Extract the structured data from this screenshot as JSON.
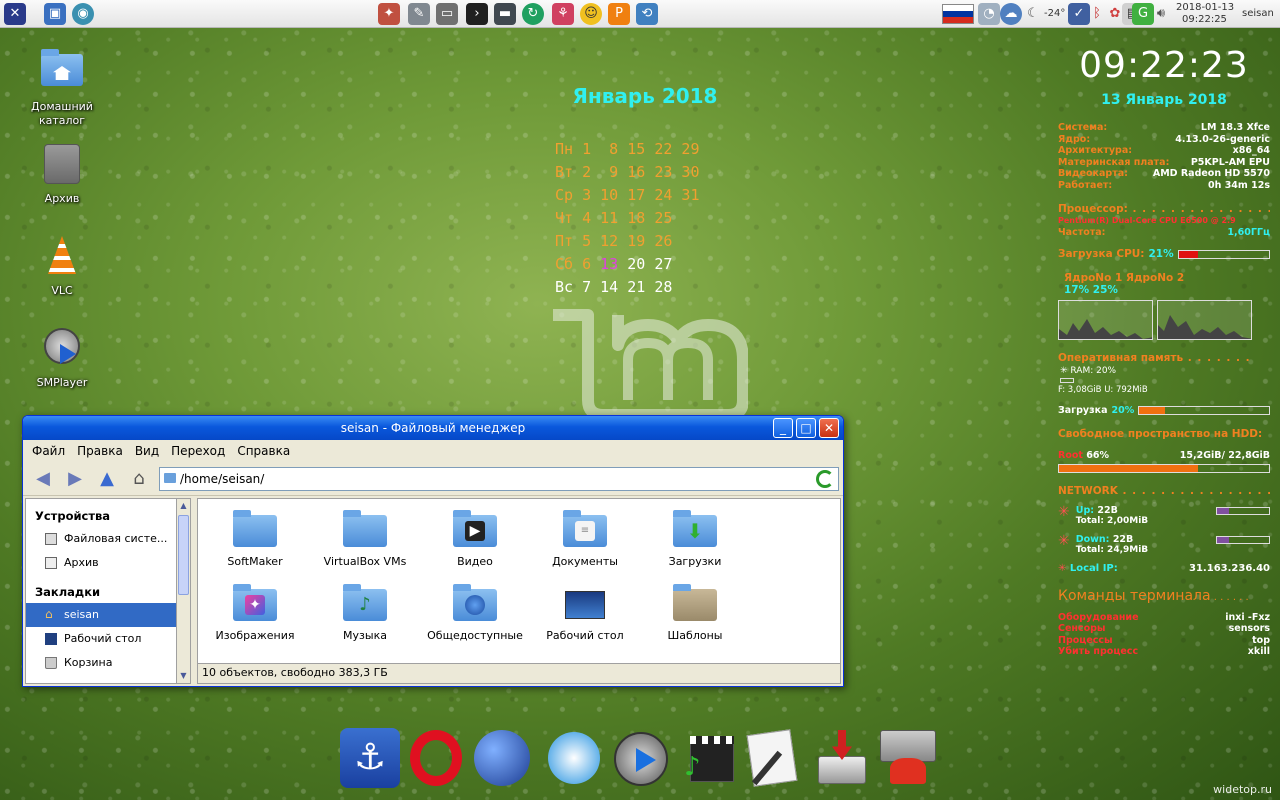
{
  "top_panel": {
    "temperature": "-24°",
    "date": "2018-01-13",
    "time": "09:22:25",
    "user": "seisan"
  },
  "desktop_icons": [
    {
      "label": "Домашний каталог",
      "icon": "home-folder-icon"
    },
    {
      "label": "Архив",
      "icon": "archive-drive-icon"
    },
    {
      "label": "VLC",
      "icon": "vlc-cone-icon"
    },
    {
      "label": "SMPlayer",
      "icon": "smplayer-icon"
    }
  ],
  "calendar": {
    "title": "Январь 2018",
    "rows": [
      {
        "day": "Пн",
        "dates": " 1  8 15 22 29"
      },
      {
        "day": "Вт",
        "dates": " 2  9 16 23 30"
      },
      {
        "day": "Ср",
        "dates": " 3 10 17 24 31"
      },
      {
        "day": "Чт",
        "dates": " 4 11 18 25"
      },
      {
        "day": "Пт",
        "dates": " 5 12 19 26"
      },
      {
        "day": "Сб",
        "pre": " 6 ",
        "today": "13",
        "post": " 20 27"
      },
      {
        "day": "Вс",
        "dates": " 7 14 21 28"
      }
    ]
  },
  "conky": {
    "clock": "09:22:23",
    "date": "13 Январь 2018",
    "system": [
      {
        "k": "Система:",
        "v": "LM 18.3 Xfce"
      },
      {
        "k": "Ядро:",
        "v": "4.13.0-26-generic"
      },
      {
        "k": "Архитектура:",
        "v": "x86_64"
      },
      {
        "k": "Материнская плата:",
        "v": "P5KPL-AM EPU"
      },
      {
        "k": "Видеокарта:",
        "v": "AMD Radeon HD 5570"
      },
      {
        "k": "Работает:",
        "v": "0h 34m 12s"
      }
    ],
    "processor_head": "Процессор:",
    "cpu_model": "Pentium(R) Dual-Core  CPU      E6500  @ 2.9",
    "freq_label": "Частота:",
    "freq_value": "1,60ГГц",
    "cpu_load_label": "Загрузка CPU:",
    "cpu_load_value": "21%",
    "cpu_load_fraction": 0.21,
    "cores_label": "ЯдроNo 1  ЯдроNo 2",
    "cores_values": "17%  25%",
    "ram_head": "Оперативная память",
    "ram_label": "RAM: 20%",
    "ram_detail": "F: 3,08GiB  U: 792MiB",
    "ram_load_label": "Загрузка",
    "ram_load_value": "20%",
    "ram_fraction": 0.2,
    "hdd_head": "Свободное пространство на HDD:",
    "root_label": "Root",
    "root_pct": "66%",
    "root_size": "15,2GiB/ 22,8GiB",
    "root_fraction": 0.66,
    "network_head": "NETWORK",
    "up_label": "Up:",
    "up_value": "22B",
    "up_total": "Total: 2,00MiB",
    "down_label": "Down:",
    "down_value": "22B",
    "down_total": "Total: 24,9MiB",
    "ip_label": "Local IP:",
    "ip_value": "31.163.236.40",
    "term_head": "Команды терминала",
    "commands": [
      {
        "k": "Оборудование",
        "v": "inxi -Fxz"
      },
      {
        "k": "Сенсоры",
        "v": "sensors"
      },
      {
        "k": "Процессы",
        "v": "top"
      },
      {
        "k": "Убить процесс",
        "v": "xkill"
      }
    ]
  },
  "file_manager": {
    "title": "seisan - Файловый менеджер",
    "menu": [
      "Файл",
      "Правка",
      "Вид",
      "Переход",
      "Справка"
    ],
    "location": "/home/seisan/",
    "devices_head": "Устройства",
    "devices": [
      "Файловая систе...",
      "Архив"
    ],
    "bookmarks_head": "Закладки",
    "bookmarks": [
      {
        "label": "seisan",
        "selected": true
      },
      {
        "label": "Рабочий стол",
        "selected": false
      },
      {
        "label": "Корзина",
        "selected": false
      }
    ],
    "files": [
      {
        "label": "SoftMaker",
        "icon": "folder-icon"
      },
      {
        "label": "VirtualBox VMs",
        "icon": "folder-icon"
      },
      {
        "label": "Видео",
        "icon": "video-folder-icon"
      },
      {
        "label": "Документы",
        "icon": "documents-folder-icon"
      },
      {
        "label": "Загрузки",
        "icon": "downloads-folder-icon"
      },
      {
        "label": "Изображения",
        "icon": "pictures-folder-icon"
      },
      {
        "label": "Музыка",
        "icon": "music-folder-icon"
      },
      {
        "label": "Общедоступные",
        "icon": "public-folder-icon"
      },
      {
        "label": "Рабочий стол",
        "icon": "desktop-folder-icon"
      },
      {
        "label": "Шаблоны",
        "icon": "templates-folder-icon"
      }
    ],
    "status": "10 объектов, свободно 383,3 ГБ"
  },
  "dock": [
    "anchor-icon",
    "opera-icon",
    "globe-icon",
    "bird-icon",
    "media-player-icon",
    "clapperboard-icon",
    "text-editor-icon",
    "installer-icon",
    "archive-manager-icon"
  ],
  "watermark": "widetop.ru",
  "colors": {
    "cpu_bar": "#e01010",
    "ram_bar": "#f07010",
    "hdd_bar": "#f07010",
    "accent": "#30f0f0",
    "orange": "#f08020"
  }
}
